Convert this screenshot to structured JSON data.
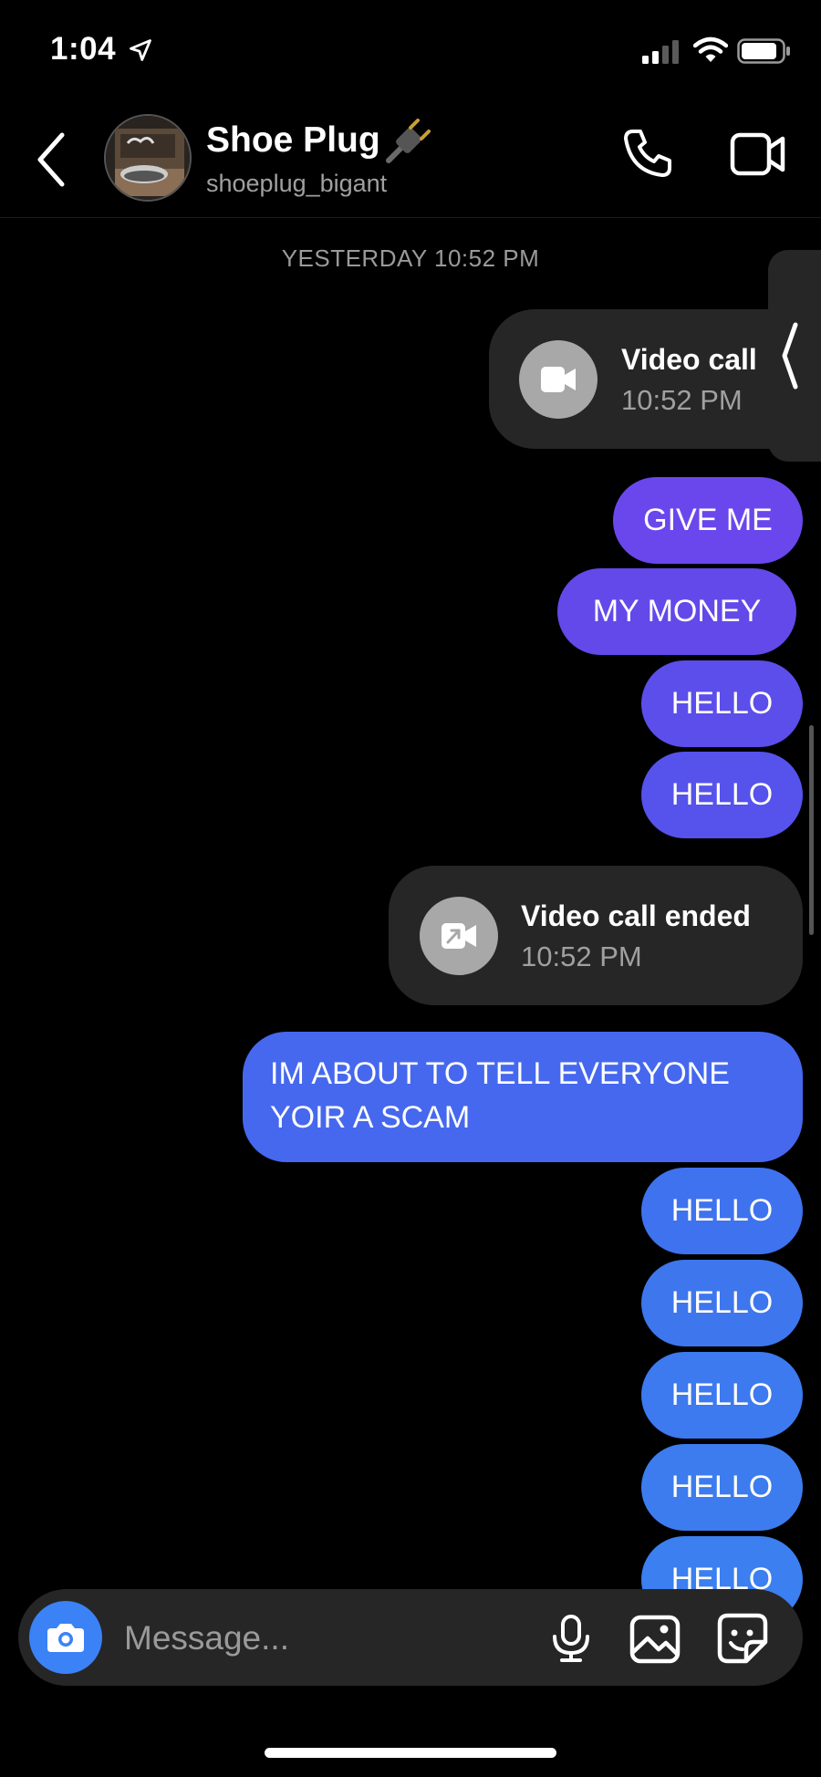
{
  "status_bar": {
    "time": "1:04"
  },
  "header": {
    "contact_name": "Shoe Plug",
    "contact_handle": "shoeplug_bigant"
  },
  "thread": {
    "date_label": "YESTERDAY 10:52 PM",
    "call_card_1": {
      "title": "Video call",
      "time": "10:52 PM"
    },
    "call_card_2": {
      "title": "Video call ended",
      "time": "10:52 PM"
    },
    "messages": [
      "GIVE ME",
      "MY MONEY",
      "HELLO",
      "HELLO",
      "IM ABOUT TO TELL EVERYONE",
      "YOIR A SCAM",
      "HELLO",
      "HELLO",
      "HELLO",
      "HELLO",
      "HELLO"
    ]
  },
  "composer": {
    "placeholder": "Message..."
  },
  "colors": {
    "bubble_purple": "#6a47ec",
    "bubble_blue": "#3f71ee",
    "accent_blue": "#3b82f6",
    "card_gray": "#262626"
  },
  "icons": [
    "location-arrow-icon",
    "signal-icon",
    "wifi-icon",
    "battery-icon",
    "back-chevron-icon",
    "plug-icon",
    "phone-icon",
    "video-camera-icon",
    "camera-icon",
    "microphone-icon",
    "gallery-icon",
    "sticker-icon"
  ]
}
